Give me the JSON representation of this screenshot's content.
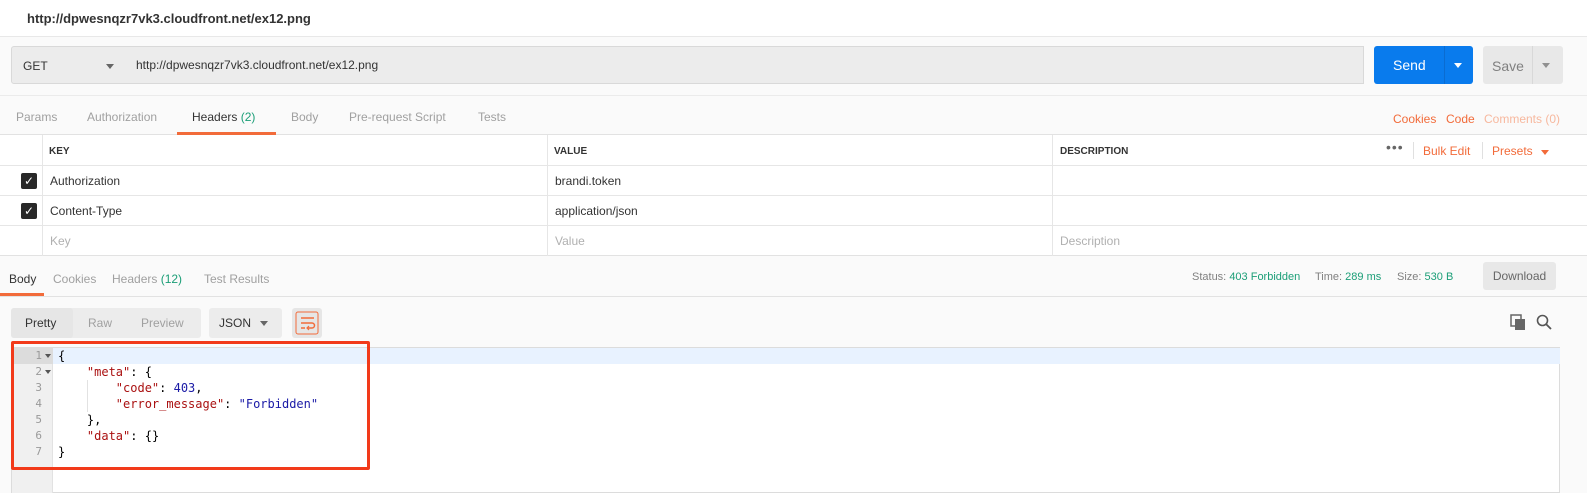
{
  "title_bar": {
    "text": "http://dpwesnqzr7vk3.cloudfront.net/ex12.png"
  },
  "request": {
    "method": "GET",
    "url": "http://dpwesnqzr7vk3.cloudfront.net/ex12.png",
    "send_label": "Send",
    "save_label": "Save"
  },
  "request_tabs": [
    {
      "label": "Params"
    },
    {
      "label": "Authorization"
    },
    {
      "label": "Headers",
      "count": "(2)"
    },
    {
      "label": "Body"
    },
    {
      "label": "Pre-request Script"
    },
    {
      "label": "Tests"
    }
  ],
  "request_links": {
    "cookies": "Cookies",
    "code": "Code",
    "comments": "Comments (0)"
  },
  "headers_table": {
    "columns": [
      "KEY",
      "VALUE",
      "DESCRIPTION"
    ],
    "rows": [
      {
        "checked": true,
        "key": "Authorization",
        "value": "brandi.token",
        "description": ""
      },
      {
        "checked": true,
        "key": "Content-Type",
        "value": "application/json",
        "description": ""
      }
    ],
    "placeholders": {
      "key": "Key",
      "value": "Value",
      "description": "Description"
    },
    "more_label": "•••",
    "bulk_edit": "Bulk Edit",
    "presets": "Presets"
  },
  "response_tabs": [
    {
      "label": "Body"
    },
    {
      "label": "Cookies"
    },
    {
      "label": "Headers",
      "count": "(12)"
    },
    {
      "label": "Test Results"
    }
  ],
  "response_status": {
    "status_label": "Status:",
    "status_value": "403 Forbidden",
    "time_label": "Time:",
    "time_value": "289 ms",
    "size_label": "Size:",
    "size_value": "530 B",
    "download": "Download"
  },
  "view_modes": [
    "Pretty",
    "Raw",
    "Preview"
  ],
  "format": "JSON",
  "code_lines": [
    {
      "n": "1",
      "text": "{"
    },
    {
      "n": "2",
      "indent": "    ",
      "key": "\"meta\"",
      "rest": ": {"
    },
    {
      "n": "3",
      "indent": "        ",
      "key": "\"code\"",
      "rest": ": ",
      "num": "403",
      "tail": ","
    },
    {
      "n": "4",
      "indent": "        ",
      "key": "\"error_message\"",
      "rest": ": ",
      "str": "\"Forbidden\""
    },
    {
      "n": "5",
      "text": "    },"
    },
    {
      "n": "6",
      "indent": "    ",
      "key": "\"data\"",
      "rest": ": {}"
    },
    {
      "n": "7",
      "text": "}"
    }
  ],
  "colors": {
    "accent": "#f26b3a",
    "send": "#097bed",
    "success": "#1b9e77",
    "highlight": "#f23a1a"
  }
}
